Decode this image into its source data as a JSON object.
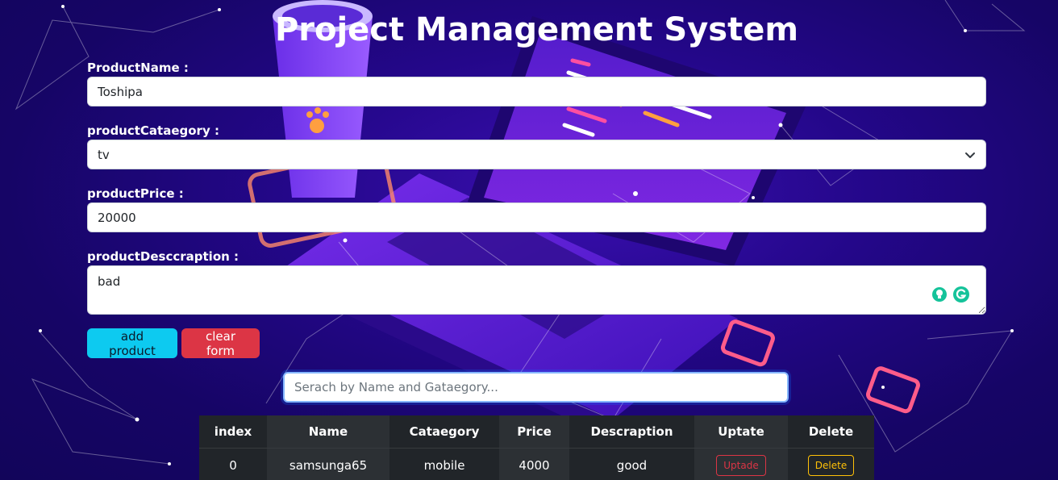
{
  "page": {
    "title": "Project Management System"
  },
  "form": {
    "name": {
      "label": "ProductName :",
      "value": "Toshipa"
    },
    "category": {
      "label": "productCataegory :",
      "value": "tv"
    },
    "price": {
      "label": "productPrice :",
      "value": "20000"
    },
    "description": {
      "label": "productDesccraption :",
      "value": "bad"
    }
  },
  "buttons": {
    "add": "add product",
    "clear": "clear form"
  },
  "search": {
    "placeholder": "Serach by Name and Gataegory..."
  },
  "table": {
    "headers": [
      "index",
      "Name",
      "Cataegory",
      "Price",
      "Descraption",
      "Uptate",
      "Delete"
    ],
    "rows": [
      {
        "index": "0",
        "name": "samsunga65",
        "category": "mobile",
        "price": "4000",
        "description": "good",
        "update": "Uptade",
        "delete": "Delete"
      }
    ]
  },
  "colors": {
    "info": "#0dcaf0",
    "danger": "#dc3545",
    "warning": "#ffc107",
    "grammarly": "#15c39a"
  }
}
